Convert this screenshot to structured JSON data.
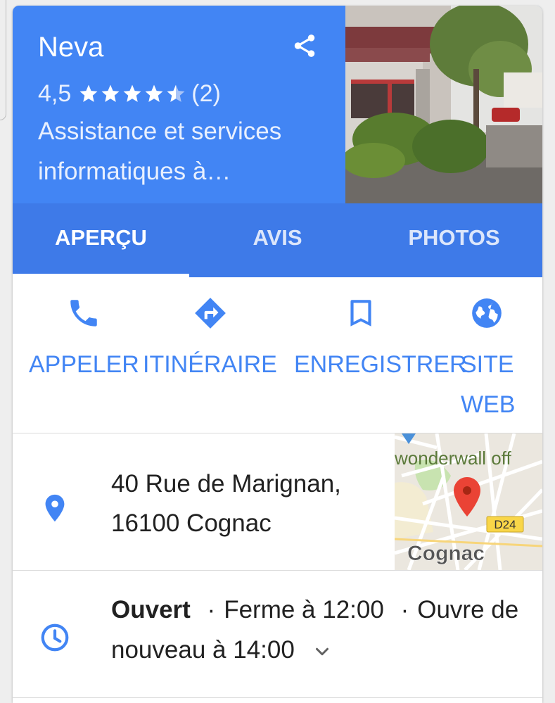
{
  "place": {
    "name": "Neva",
    "rating": "4,5",
    "stars": 4.5,
    "review_count": "(2)",
    "category": "Assistance et services informatiques à…"
  },
  "tabs": [
    {
      "label": "APERÇU",
      "active": true
    },
    {
      "label": "AVIS",
      "active": false
    },
    {
      "label": "PHOTOS",
      "active": false
    }
  ],
  "actions": [
    {
      "label": "APPELER",
      "icon": "phone-icon"
    },
    {
      "label": "ITINÉRAIRE",
      "icon": "directions-icon"
    },
    {
      "label": "ENREGISTRER",
      "icon": "bookmark-icon"
    },
    {
      "label_line1": "SITE",
      "label_line2": "WEB",
      "icon": "globe-icon"
    }
  ],
  "address": {
    "line1": "40 Rue de Marignan,",
    "line2": "16100 Cognac",
    "icon": "location-pin-icon"
  },
  "map": {
    "place_label": "wonderwall off",
    "city_label": "Cognac",
    "road_label": "D24"
  },
  "hours": {
    "status": "Ouvert",
    "separator": "·",
    "closes": "Ferme à 12:00",
    "reopens_part1": "Ouvre",
    "reopens_part2": "de nouveau à 14:00",
    "icon": "clock-icon"
  },
  "colors": {
    "header": "#4285f4",
    "tabs": "#3e7ae8",
    "accent": "#4285f4",
    "map_pin": "#ea4335"
  }
}
